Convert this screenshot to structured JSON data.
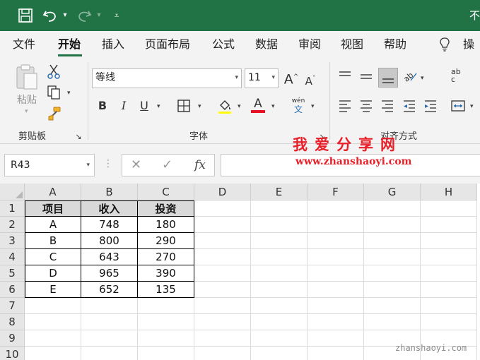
{
  "title_bar": {
    "title": "不",
    "icons": [
      "save-icon",
      "undo-icon",
      "redo-icon",
      "customize-toolbar-icon"
    ]
  },
  "tabs": [
    {
      "label": "文件",
      "name": "tab-file"
    },
    {
      "label": "开始",
      "name": "tab-home",
      "active": true
    },
    {
      "label": "插入",
      "name": "tab-insert"
    },
    {
      "label": "页面布局",
      "name": "tab-page-layout"
    },
    {
      "label": "公式",
      "name": "tab-formulas"
    },
    {
      "label": "数据",
      "name": "tab-data"
    },
    {
      "label": "审阅",
      "name": "tab-review"
    },
    {
      "label": "视图",
      "name": "tab-view"
    },
    {
      "label": "帮助",
      "name": "tab-help"
    },
    {
      "label": "操",
      "name": "tab-tell-me"
    }
  ],
  "ribbon": {
    "clipboard": {
      "label": "剪贴板",
      "paste_label": "粘贴"
    },
    "font": {
      "label": "字体",
      "font_name": "等线",
      "font_size": "11",
      "phonetic_top": "wén",
      "phonetic_bottom": "文",
      "font_color": "#e81123"
    },
    "alignment": {
      "label": "对齐方式",
      "wrap_text_top": "ab",
      "wrap_text_bottom": "c"
    }
  },
  "formula_bar": {
    "name_box": "R43",
    "formula": ""
  },
  "watermark": {
    "title": "我爱分享网",
    "url": "www.zhanshaoyi.com",
    "corner": "zhanshaoyi.com"
  },
  "sheet": {
    "columns": [
      "A",
      "B",
      "C",
      "D",
      "E",
      "F",
      "G",
      "H"
    ],
    "rows": [
      "1",
      "2",
      "3",
      "4",
      "5",
      "6",
      "7",
      "8",
      "9",
      "10"
    ],
    "table": {
      "headers": [
        "项目",
        "收入",
        "投资"
      ],
      "rows": [
        [
          "A",
          "748",
          "180"
        ],
        [
          "B",
          "800",
          "290"
        ],
        [
          "C",
          "643",
          "270"
        ],
        [
          "D",
          "965",
          "390"
        ],
        [
          "E",
          "652",
          "135"
        ]
      ]
    }
  },
  "colors": {
    "brand_green": "#217346",
    "watermark_red": "#e8202a"
  }
}
